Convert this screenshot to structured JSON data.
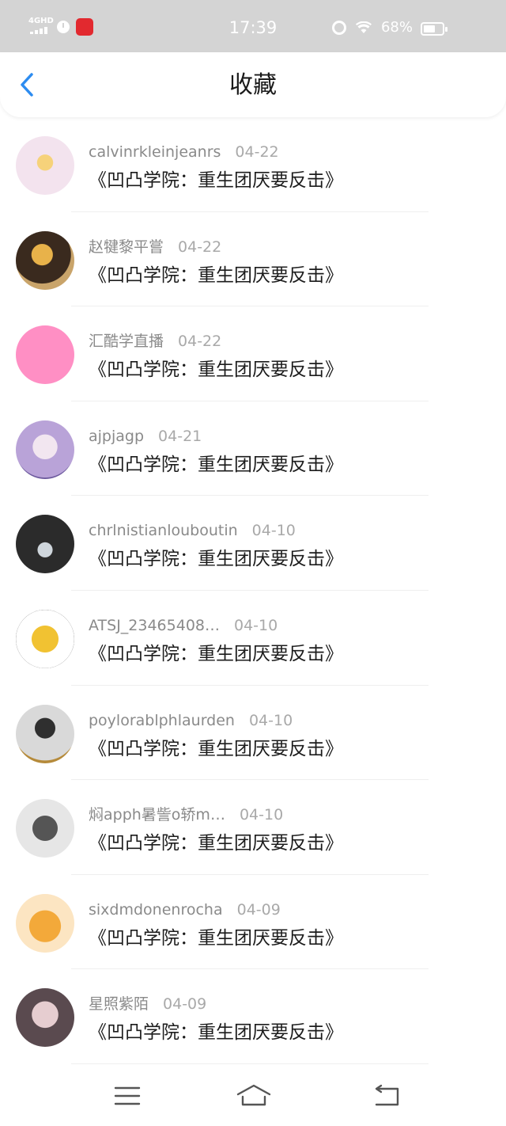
{
  "status_bar": {
    "network": "4GHD",
    "time": "17:39",
    "battery_text": "68%",
    "battery_level": 0.68
  },
  "header": {
    "title": "收藏",
    "back_icon": "chevron-left-icon"
  },
  "items": [
    {
      "user": "calvinrkleinjeanrs",
      "date": "04-22",
      "title": "《凹凸学院：重生团厌要反击》"
    },
    {
      "user": "赵犍黎平嘗",
      "date": "04-22",
      "title": "《凹凸学院：重生团厌要反击》"
    },
    {
      "user": "汇酷学直播",
      "date": "04-22",
      "title": "《凹凸学院：重生团厌要反击》"
    },
    {
      "user": "ajpjagp",
      "date": "04-21",
      "title": "《凹凸学院：重生团厌要反击》"
    },
    {
      "user": "chrlnistianlouboutin",
      "date": "04-10",
      "title": "《凹凸学院：重生团厌要反击》"
    },
    {
      "user": "ATSJ_23465408…",
      "date": "04-10",
      "title": "《凹凸学院：重生团厌要反击》"
    },
    {
      "user": "poylorablphlaurden",
      "date": "04-10",
      "title": "《凹凸学院：重生团厌要反击》"
    },
    {
      "user": "焖apph暑訾o轿m…",
      "date": "04-10",
      "title": "《凹凸学院：重生团厌要反击》"
    },
    {
      "user": "sixdmdonenrocha",
      "date": "04-09",
      "title": "《凹凸学院：重生团厌要反击》"
    },
    {
      "user": "星照紫陌",
      "date": "04-09",
      "title": "《凹凸学院：重生团厌要反击》"
    }
  ],
  "nav_bar": {
    "menu_icon": "menu-icon",
    "home_icon": "home-icon",
    "back_icon": "return-icon"
  },
  "colors": {
    "status_bar_bg": "#d4d4d4",
    "accent": "#2d8cf0",
    "username": "#8a8a8a",
    "date": "#a9a9a9"
  }
}
